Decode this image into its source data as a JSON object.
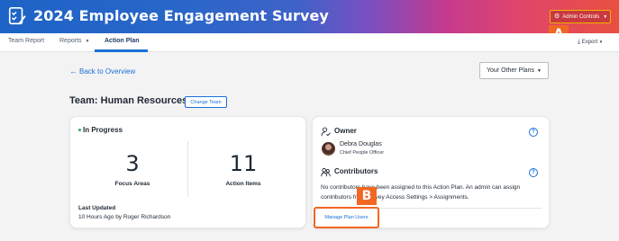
{
  "header": {
    "title": "2024 Employee Engagement Survey",
    "admin_controls_label": "Admin Controls",
    "gradient_colors": [
      "#1d63c6",
      "#7b4fc0",
      "#c43a8e",
      "#e85040"
    ]
  },
  "callouts": {
    "a": "A",
    "b": "B",
    "color": "#f26722"
  },
  "nav": {
    "team_report": "Team Report",
    "reports": "Reports",
    "action_plan": "Action Plan",
    "export": "Export",
    "active_color": "#1a6fd8"
  },
  "main": {
    "back_link": "Back to Overview",
    "other_plans": "Your Other Plans",
    "team_heading": "Team: Human Resources",
    "change_team": "Change Team"
  },
  "progress_card": {
    "status": "In Progress",
    "status_color": "#2faa60",
    "focus_areas_value": "3",
    "focus_areas_label": "Focus Areas",
    "action_items_value": "11",
    "action_items_label": "Action Items",
    "last_updated_label": "Last Updated",
    "last_updated_text": "10 Hours Ago by Roger Richardson"
  },
  "people_card": {
    "owner_title": "Owner",
    "owner_name": "Debra Douglas",
    "owner_role": "Chief People Officer",
    "contributors_title": "Contributors",
    "contributors_text": "No contributors have been assigned to this Action Plan. An admin can assign contributors from Survey Access Settings > Assignments.",
    "manage_link": "Manage Plan Users",
    "help_symbol": "?"
  }
}
